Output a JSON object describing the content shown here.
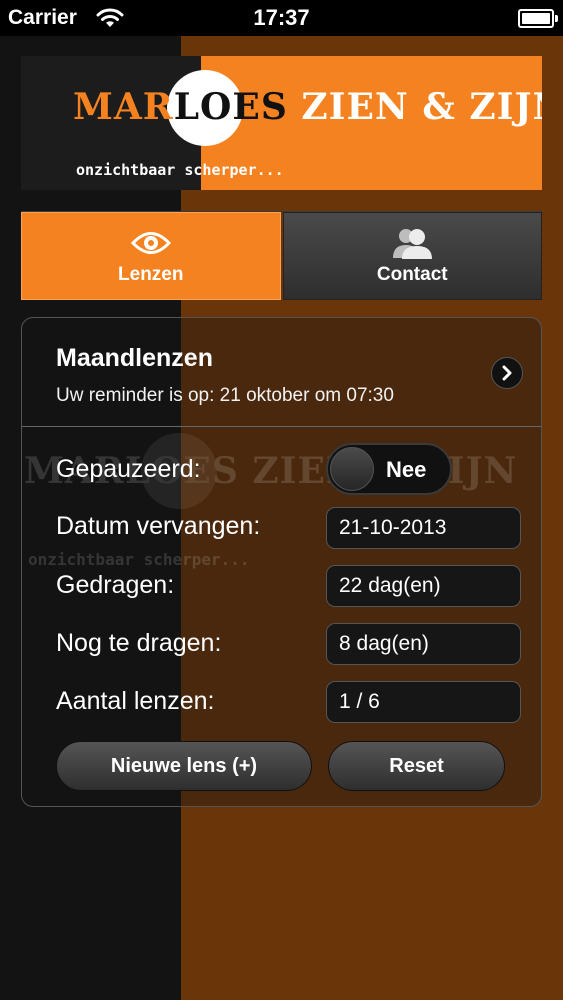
{
  "status_bar": {
    "carrier": "Carrier",
    "time": "17:37"
  },
  "logo": {
    "title_part1": "MAR",
    "title_part2": "LOES",
    "title_part3": " ZIEN & ZIJN",
    "subtitle_part1": "onzichtbaar",
    "subtitle_part2": " scherper..."
  },
  "tabs": [
    {
      "label": "Lenzen",
      "icon": "eye-icon",
      "active": true
    },
    {
      "label": "Contact",
      "icon": "contacts-icon",
      "active": false
    }
  ],
  "lens": {
    "title": "Maandlenzen",
    "reminder": "Uw reminder is op: 21 oktober om 07:30"
  },
  "fields": {
    "paused_label": "Gepauzeerd:",
    "paused_value": "Nee",
    "replace_date_label": "Datum vervangen:",
    "replace_date_value": "21-10-2013",
    "worn_label": "Gedragen:",
    "worn_value": "22 dag(en)",
    "remaining_label": "Nog te dragen:",
    "remaining_value": "8 dag(en)",
    "count_label": "Aantal lenzen:",
    "count_value": "1 / 6"
  },
  "buttons": {
    "new_lens": "Nieuwe lens (+)",
    "reset": "Reset"
  },
  "colors": {
    "accent": "#f58220",
    "dark": "#131313",
    "brown": "#6a3509"
  }
}
